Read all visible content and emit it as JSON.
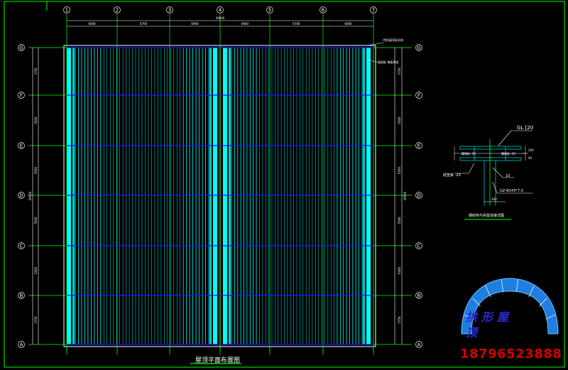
{
  "drawing": {
    "plan_title": "屋顶平面布置图",
    "column_axes": [
      "1",
      "2",
      "3",
      "4",
      "5",
      "6",
      "7"
    ],
    "row_axes": [
      "G",
      "F",
      "E",
      "D",
      "C",
      "B",
      "A"
    ],
    "top_dims": [
      "6000",
      "6700",
      "6900",
      "6900",
      "6700",
      "6000"
    ],
    "top_total": "39600",
    "left_dims": [
      "3750",
      "5500",
      "5500",
      "5500",
      "5500",
      "3750"
    ],
    "left_total": "29500",
    "right_dims": [
      "3750",
      "5500",
      "5500",
      "5500",
      "5500",
      "3750"
    ],
    "right_total": "29500",
    "panel_note_1": "拱形屋顶采光带",
    "panel_note_2": "屋面板 钢板厚度"
  },
  "detail": {
    "title": "钢结构与拱屋连接详图",
    "gl_label": "GL [20",
    "flange_label_left": "翼缘板 -10",
    "flange_label_right": "翼缘板 -10",
    "plate_label": "底垫板 -20",
    "gz_label": "GZ-Φ245*7.0",
    "dim_200": "200",
    "dim_40": "40",
    "dim_300": "300",
    "weld_label": "10"
  },
  "watermark": {
    "text": "拱形屋顶",
    "phone": "18796523888"
  },
  "colors": {
    "grid_green": "#00ff00",
    "blue_line": "#1a1aff",
    "cyan_panel": "#00c8c8",
    "bright_cyan": "#00ffff",
    "white": "#ffffff",
    "phone_red": "#d20000",
    "arch_blue": "#1e7fe0"
  }
}
